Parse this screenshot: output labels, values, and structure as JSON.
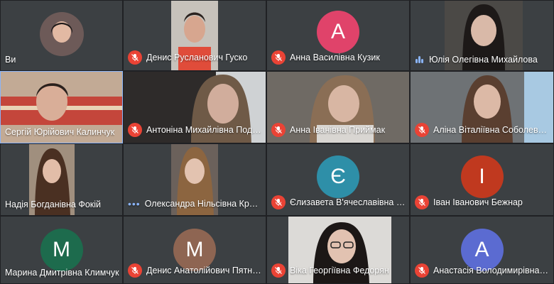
{
  "participants": [
    {
      "name": "Ви",
      "status": "none",
      "type": "photo",
      "video_bg": "#2f3136",
      "avatar_bg": "#6d5a58"
    },
    {
      "name": "Денис Русланович Гуско",
      "status": "muted",
      "type": "video",
      "video_bg": "#b9b4ae"
    },
    {
      "name": "Анна Василівна Кузик",
      "status": "muted",
      "type": "avatar",
      "letter": "A",
      "avatar_bg": "#e0436a"
    },
    {
      "name": "Юлія Олегівна Михайлова",
      "status": "speaking-bars",
      "type": "video",
      "video_bg": "#55534f"
    },
    {
      "name": "Сергій Юрійович Калинчук",
      "status": "none",
      "type": "video",
      "video_bg": "#c9b8a5",
      "speaking": true
    },
    {
      "name": "Антоніна Михайлівна Подолянчук",
      "status": "muted",
      "type": "video",
      "video_bg": "#3b3836"
    },
    {
      "name": "Анна Іванівна Приймак",
      "status": "muted",
      "type": "video",
      "video_bg": "#6c6862"
    },
    {
      "name": "Аліна Віталіївна Соболевська",
      "status": "muted",
      "type": "video",
      "video_bg": "#7b7f83"
    },
    {
      "name": "Надія Богданівна Фокій",
      "status": "none",
      "type": "video",
      "video_bg": "#8b7c6f"
    },
    {
      "name": "Олександра Нільсівна Кравченко",
      "status": "dots",
      "type": "video",
      "video_bg": "#5c5450"
    },
    {
      "name": "Єлизавета В'ячеславівна Грищенко",
      "status": "muted",
      "type": "avatar",
      "letter": "Є",
      "avatar_bg": "#2e8fa8"
    },
    {
      "name": "Іван Іванович Бежнар",
      "status": "muted",
      "type": "avatar",
      "letter": "І",
      "avatar_bg": "#c0391f"
    },
    {
      "name": "Марина Дмитрівна Климчук",
      "status": "none",
      "type": "avatar",
      "letter": "M",
      "avatar_bg": "#1d6b4d"
    },
    {
      "name": "Денис Анатолійович Пятницький",
      "status": "muted",
      "type": "avatar",
      "letter": "M",
      "avatar_bg": "#8e6552"
    },
    {
      "name": "Віка Георгіївна Федорян",
      "status": "muted",
      "type": "video",
      "video_bg": "#d8d6d3"
    },
    {
      "name": "Анастасія Володимирівна Коваль",
      "status": "muted",
      "type": "avatar",
      "letter": "A",
      "avatar_bg": "#5b6bd1"
    }
  ]
}
